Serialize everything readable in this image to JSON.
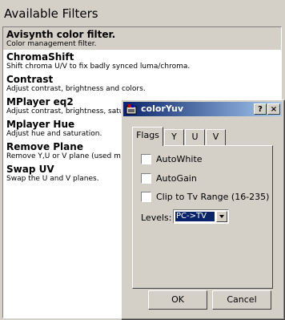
{
  "panel": {
    "title": "Available Filters"
  },
  "filters": [
    {
      "name": "Avisynth color filter.",
      "description": "Color management filter."
    },
    {
      "name": "ChromaShift",
      "description": "Shift chroma U/V to fix badly synced luma/chroma."
    },
    {
      "name": "Contrast",
      "description": "Adjust contrast, brightness and colors."
    },
    {
      "name": "MPlayer eq2",
      "description": "Adjust contrast, brightness, saturat"
    },
    {
      "name": "Mplayer Hue",
      "description": "Adjust hue and saturation."
    },
    {
      "name": "Remove Plane",
      "description": "Remove Y,U or V plane (used mai"
    },
    {
      "name": "Swap UV",
      "description": "Swap the U and V planes."
    }
  ],
  "dialog": {
    "title": "colorYuv",
    "help_label": "?",
    "close_label": "×",
    "tabs": [
      {
        "label": "Flags"
      },
      {
        "label": "Y"
      },
      {
        "label": "U"
      },
      {
        "label": "V"
      }
    ],
    "checkboxes": [
      {
        "label": "AutoWhite"
      },
      {
        "label": "AutoGain"
      },
      {
        "label": "Clip to Tv Range (16-235)"
      }
    ],
    "levels_label": "Levels:",
    "levels_value": "PC->TV",
    "ok_label": "OK",
    "cancel_label": "Cancel"
  }
}
